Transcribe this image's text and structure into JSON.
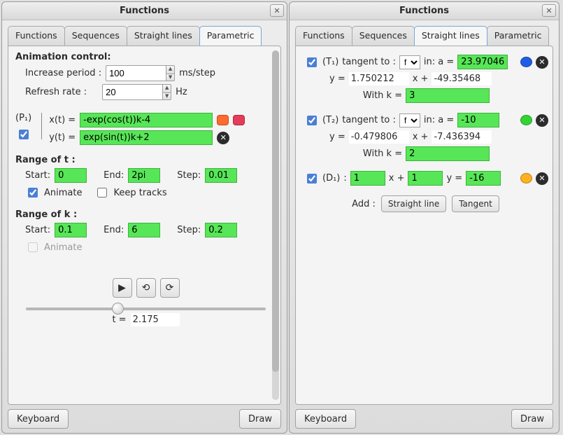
{
  "window_title": "Functions",
  "tabs": {
    "functions": "Functions",
    "sequences": "Sequences",
    "straight": "Straight lines",
    "parametric": "Parametric"
  },
  "left": {
    "anim_heading": "Animation control:",
    "inc_period_label": "Increase period :",
    "inc_period_value": "100",
    "inc_period_unit": "ms/step",
    "refresh_label": "Refresh rate :",
    "refresh_value": "20",
    "refresh_unit": "Hz",
    "p1_label": "(P₁)",
    "xt_label": "x(t) =",
    "xt_value": "-exp(cos(t))k-4",
    "yt_label": "y(t) =",
    "yt_value": "exp(sin(t))k+2",
    "range_t_heading": "Range of t :",
    "range_k_heading": "Range of k :",
    "start_label": "Start:",
    "end_label": "End:",
    "step_label": "Step:",
    "t_start": "0",
    "t_end": "2pi",
    "t_step": "0.01",
    "k_start": "0.1",
    "k_end": "6",
    "k_step": "0.2",
    "animate_label": "Animate",
    "keep_label": "Keep tracks",
    "t_readout_label": "t = ",
    "t_readout_value": "2.175",
    "slider_percent": 36
  },
  "right": {
    "t1_label": "(T₁)",
    "t2_label": "(T₂)",
    "d1_label": "(D₁)",
    "tangent_to": "tangent to :",
    "func_options": [
      "f"
    ],
    "func_selected": "f",
    "in_a": "in: a =",
    "t1_a": "23.97046",
    "t2_a": "-10",
    "y_eq": "y =",
    "x_plus": "x +",
    "t1_m": "1.750212",
    "t1_b": "-49.35468",
    "t2_m": "-0.479806",
    "t2_b": "-7.436394",
    "with_k": "With k =",
    "t1_k": "3",
    "t2_k": "2",
    "d1_x": "1",
    "d1_c": "1",
    "d1_r": "-16",
    "add_label": "Add :",
    "btn_straight": "Straight line",
    "btn_tangent": "Tangent"
  },
  "buttons": {
    "keyboard": "Keyboard",
    "draw": "Draw"
  }
}
